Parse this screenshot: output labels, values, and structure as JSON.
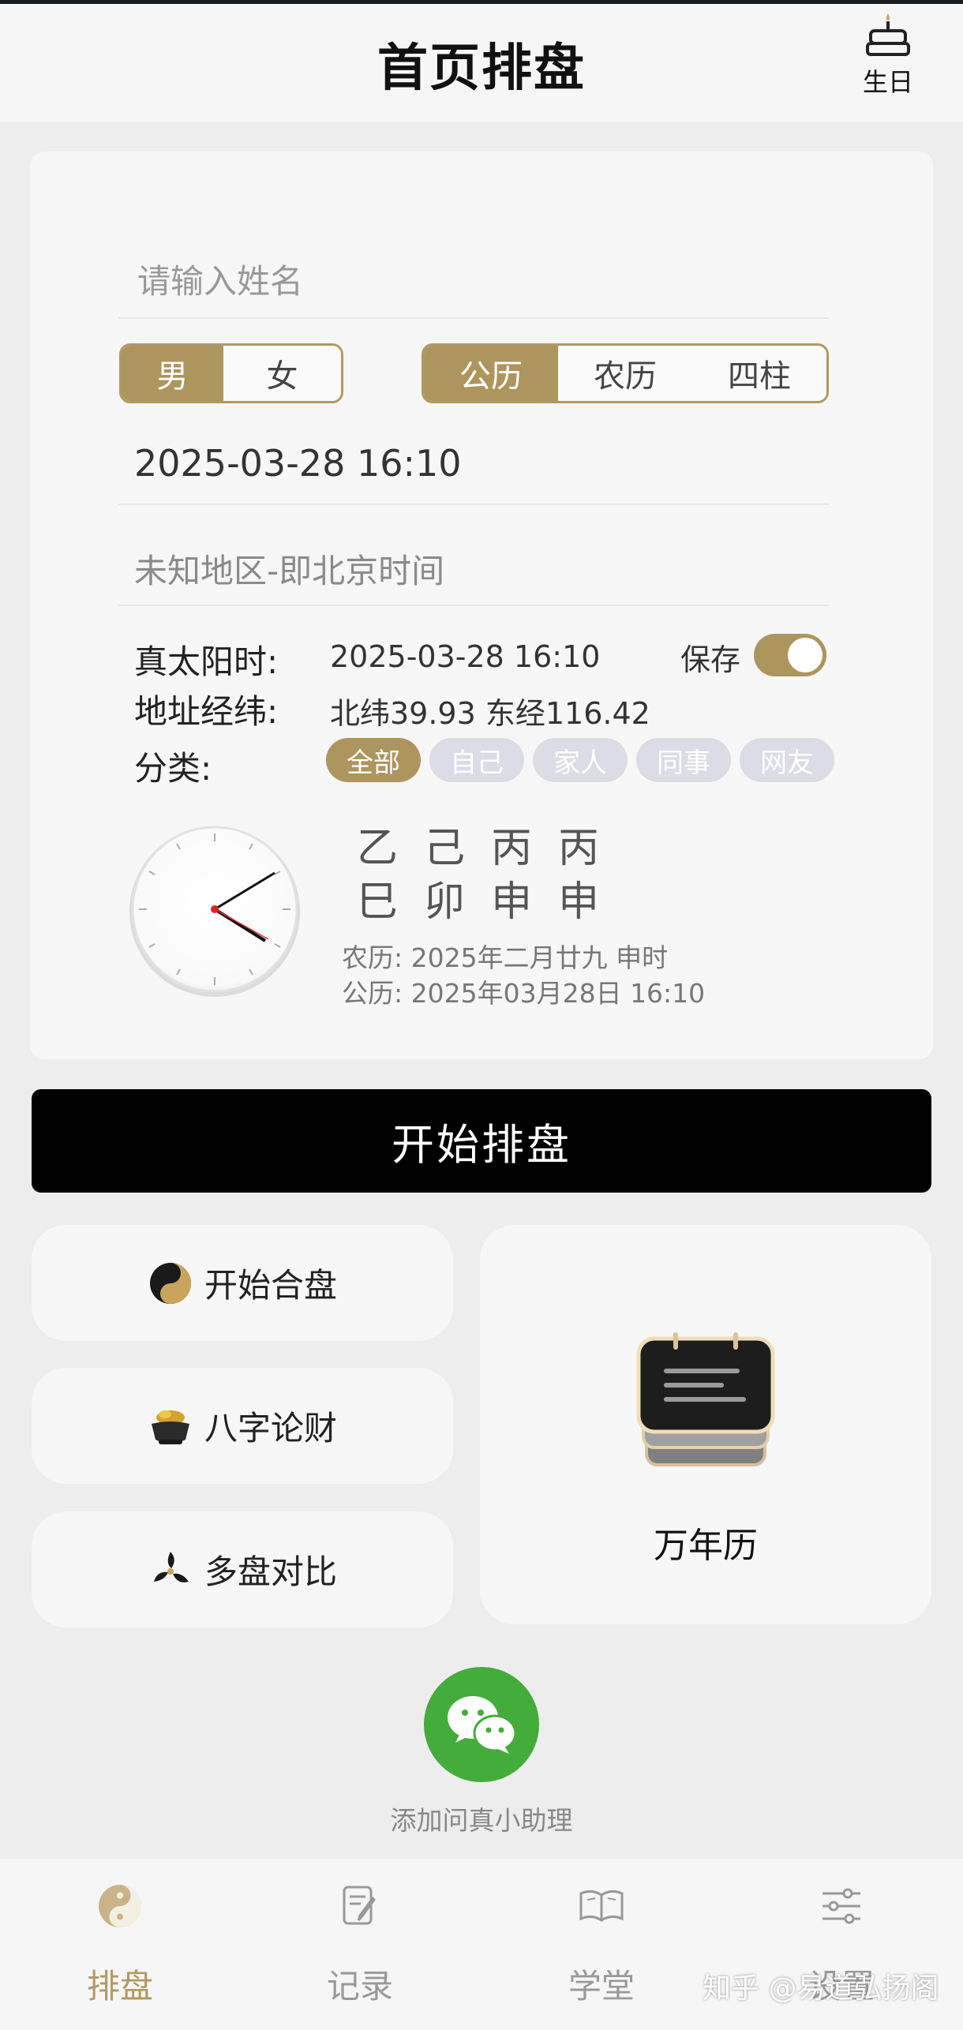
{
  "header": {
    "title": "首页排盘",
    "birthday_label": "生日",
    "birthday_icon": "cake-icon"
  },
  "form": {
    "name_placeholder": "请输入姓名",
    "gender": {
      "options": [
        "男",
        "女"
      ],
      "selected": "男"
    },
    "calendar": {
      "options": [
        "公历",
        "农历",
        "四柱"
      ],
      "selected": "公历"
    },
    "datetime": "2025-03-28 16:10",
    "region": "未知地区-即北京时间",
    "true_solar": {
      "label": "真太阳时:",
      "value": "2025-03-28 16:10"
    },
    "coords": {
      "label": "地址经纬:",
      "value": "北纬39.93 东经116.42"
    },
    "save": {
      "label": "保存",
      "on": true
    },
    "category": {
      "label": "分类:",
      "options": [
        "全部",
        "自己",
        "家人",
        "同事",
        "网友"
      ],
      "selected": "全部"
    }
  },
  "bazi": {
    "stems": [
      "乙",
      "己",
      "丙",
      "丙"
    ],
    "branches": [
      "巳",
      "卯",
      "申",
      "申"
    ],
    "lunar": "农历:  2025年二月廿九 申时",
    "solar": "公历:  2025年03月28日 16:10",
    "clock_time": "16:10"
  },
  "start_button": "开始排盘",
  "tiles": [
    {
      "label": "开始合盘",
      "icon": "yinyang-icon"
    },
    {
      "label": "八字论财",
      "icon": "treasure-bowl-icon"
    },
    {
      "label": "多盘对比",
      "icon": "triskelion-icon"
    }
  ],
  "calendar_tile": {
    "label": "万年历",
    "icon": "calendar-icon"
  },
  "assistant": {
    "label": "添加问真小助理",
    "icon": "wechat-icon",
    "color": "#43ac3a"
  },
  "tabbar": [
    {
      "label": "排盘",
      "icon": "taiji-icon",
      "active": true
    },
    {
      "label": "记录",
      "icon": "note-edit-icon",
      "active": false
    },
    {
      "label": "学堂",
      "icon": "book-icon",
      "active": false
    },
    {
      "label": "设置",
      "icon": "sliders-icon",
      "active": false
    }
  ],
  "watermark": "知乎 @易道弘扬阁",
  "colors": {
    "accent": "#ad955e",
    "inactive_chip": "#dcdce6",
    "background": "#ededed"
  }
}
